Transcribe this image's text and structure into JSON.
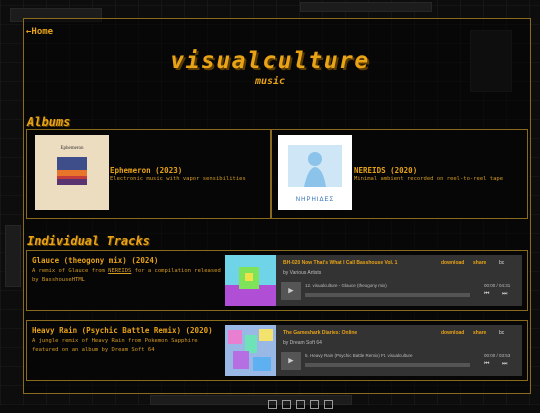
{
  "nav": {
    "home": "←Home"
  },
  "header": {
    "title": "visualculture",
    "subtitle": "music"
  },
  "sections": {
    "albums": "Albums",
    "tracks": "Individual Tracks"
  },
  "albums": [
    {
      "name": "Ephemeron (2023)",
      "desc": "Electronic music with vapor sensibilities",
      "cover_text": "Ephemeron"
    },
    {
      "name": "NEREIDS (2020)",
      "desc": "Minimal ambient recorded on reel-to-reel tape",
      "cover_text": "ΝΗΡΗΙΔΕΣ"
    }
  ],
  "tracks": [
    {
      "name": "Glauce (theogony mix) (2024)",
      "desc_pre": "A remix of Glauce from ",
      "desc_link": "NEREIDS",
      "desc_post": " for a compilation released by BasshouseHTML",
      "player": {
        "title": "BH-020 Now That's What I Call Basshouse Vol. 1",
        "artist": "by Various Artists",
        "download": "download",
        "share": "share",
        "brand": "bc",
        "track": "12.  visualculture - Glauce (theogony mix)",
        "time": "00:00 / 04:31",
        "progress": 0
      }
    },
    {
      "name": "Heavy Rain (Psychic Battle Remix) (2020)",
      "desc_pre": "A jungle remix of Heavy Rain from Pokemon Sapphire featured on an album by Dream Soft 64",
      "desc_link": "",
      "desc_post": "",
      "player": {
        "title": "The Gameshark Diaries: Online",
        "artist": "by Dream Soft 64",
        "download": "download",
        "share": "share",
        "brand": "bc",
        "track": "5.  Heavy Rain (Psychic Battle Remix) Ft. visualculture",
        "time": "00:00 / 03:53",
        "progress": 0
      }
    }
  ],
  "colors": {
    "accent": "#e8a317",
    "border": "#8a6a1c",
    "background": "#0b0b0b",
    "player": "#333333"
  },
  "icons": {
    "play": "play-icon",
    "prev": "previous-icon",
    "next": "next-icon"
  }
}
